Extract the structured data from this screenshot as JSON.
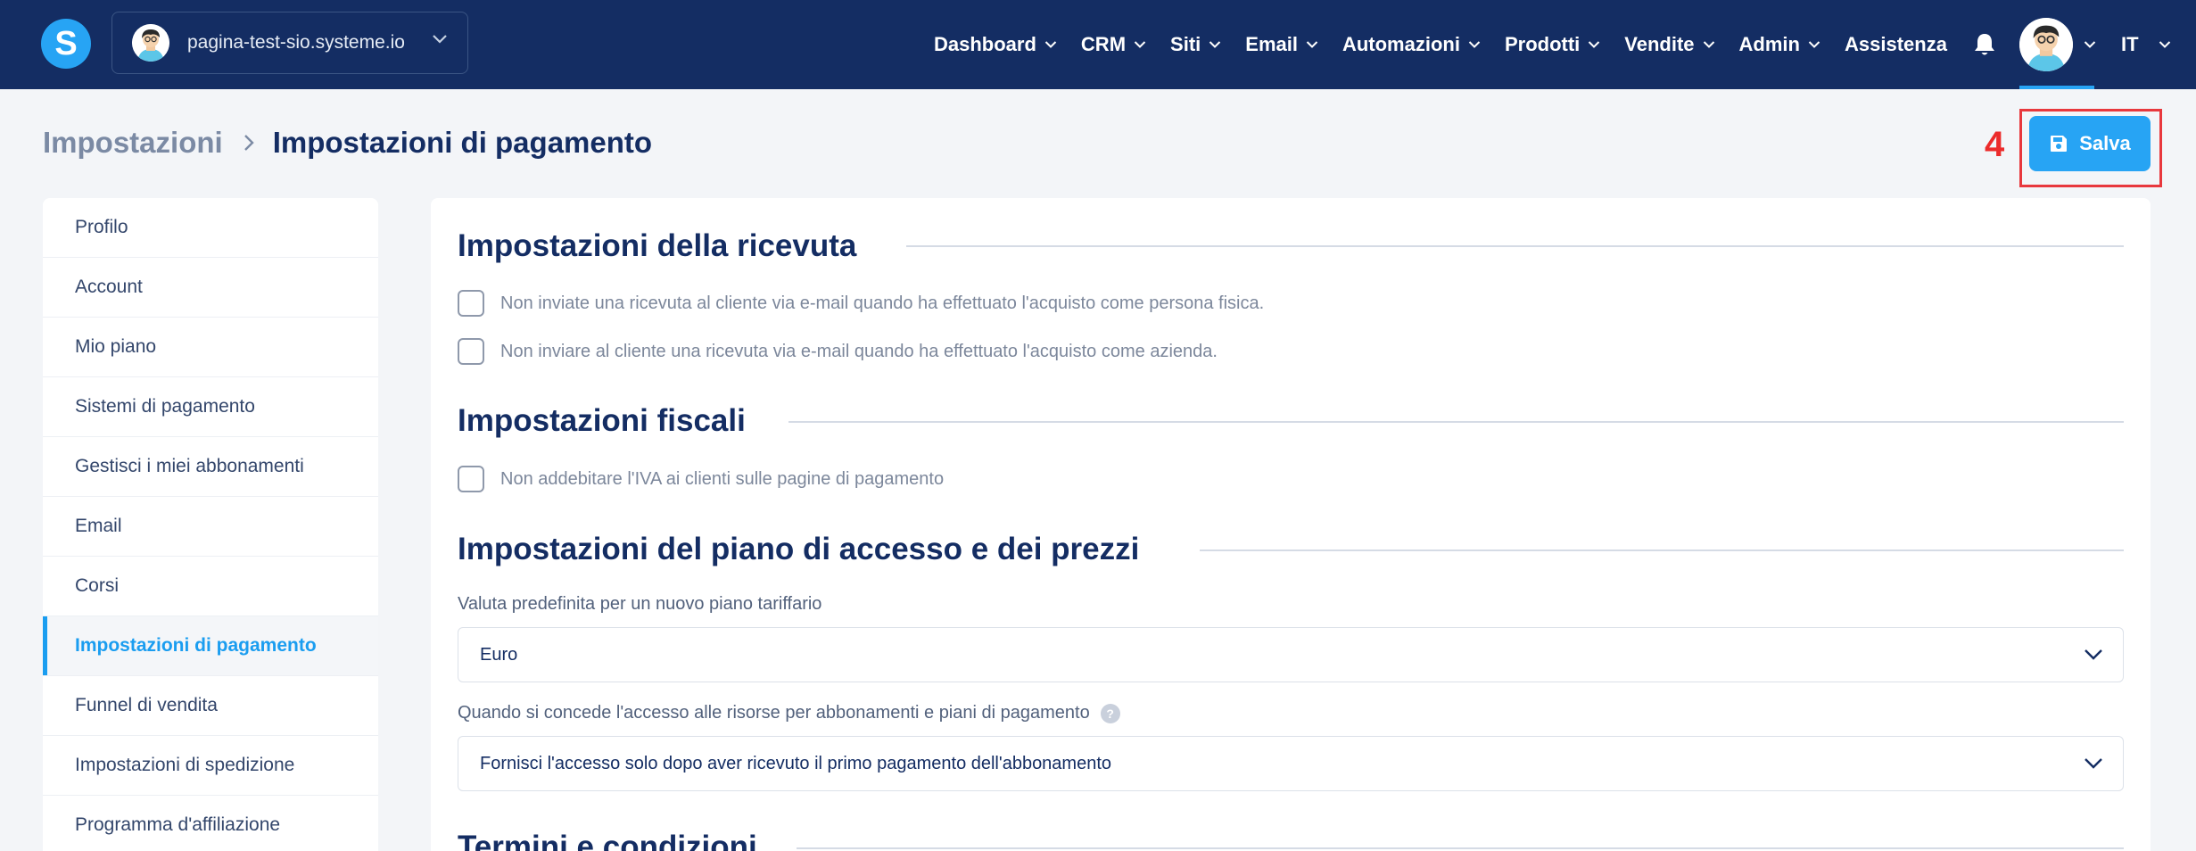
{
  "topbar": {
    "logo_letter": "S",
    "site_name": "pagina-test-sio.systeme.io",
    "nav": [
      {
        "label": "Dashboard"
      },
      {
        "label": "CRM"
      },
      {
        "label": "Siti"
      },
      {
        "label": "Email"
      },
      {
        "label": "Automazioni"
      },
      {
        "label": "Prodotti"
      },
      {
        "label": "Vendite"
      },
      {
        "label": "Admin"
      },
      {
        "label": "Assistenza"
      }
    ],
    "language": "IT",
    "icons": [
      "chevron-down-icon",
      "bell-icon",
      "avatar"
    ]
  },
  "header": {
    "breadcrumb_parent": "Impostazioni",
    "breadcrumb_current": "Impostazioni di pagamento",
    "step_number": "4",
    "save_label": "Salva",
    "save_icon": "floppy-disk-icon"
  },
  "sidebar": {
    "items": [
      {
        "label": "Profilo"
      },
      {
        "label": "Account"
      },
      {
        "label": "Mio piano"
      },
      {
        "label": "Sistemi di pagamento"
      },
      {
        "label": "Gestisci i miei abbonamenti"
      },
      {
        "label": "Email"
      },
      {
        "label": "Corsi"
      },
      {
        "label": "Impostazioni di pagamento"
      },
      {
        "label": "Funnel di vendita"
      },
      {
        "label": "Impostazioni di spedizione"
      },
      {
        "label": "Programma d'affiliazione"
      }
    ],
    "active_index": 7
  },
  "main": {
    "receipt": {
      "title": "Impostazioni della ricevuta",
      "checkbox_person": "Non inviate una ricevuta al cliente via e-mail quando ha effettuato l'acquisto come persona fisica.",
      "checkbox_company": "Non inviare al cliente una ricevuta via e-mail quando ha effettuato l'acquisto come azienda."
    },
    "fiscal": {
      "title": "Impostazioni fiscali",
      "checkbox_vat": "Non addebitare l'IVA ai clienti sulle pagine di pagamento"
    },
    "access": {
      "title": "Impostazioni del piano di accesso e dei prezzi",
      "currency_label": "Valuta predefinita per un nuovo piano tariffario",
      "currency_value": "Euro",
      "access_label": "Quando si concede l'accesso alle risorse per abbonamenti e piani di pagamento",
      "access_help": "?",
      "access_value": "Fornisci l'accesso solo dopo aver ricevuto il primo pagamento dell'abbonamento"
    },
    "terms": {
      "title": "Termini e condizioni"
    }
  },
  "colors": {
    "topbar": "#142d63",
    "accent": "#27a4f4",
    "highlight": "#e8383d"
  }
}
